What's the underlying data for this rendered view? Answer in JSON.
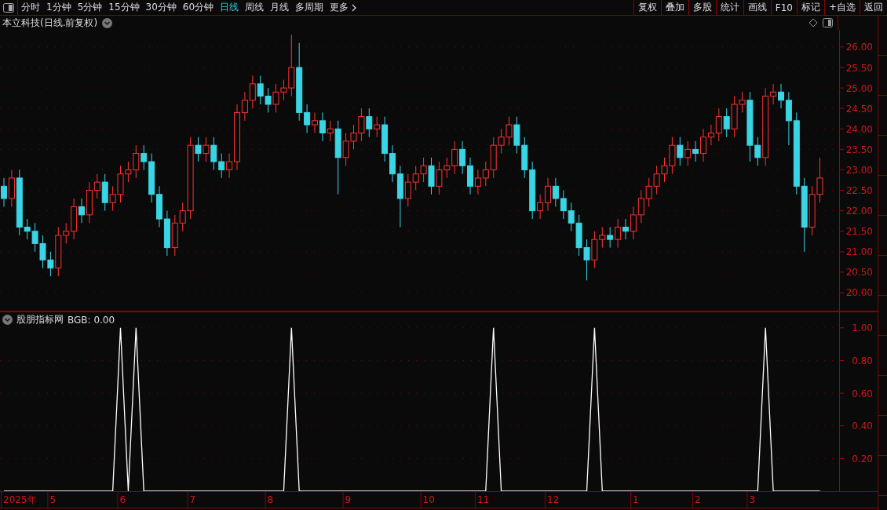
{
  "toolbar": {
    "periods": [
      {
        "label": "分时",
        "selected": false
      },
      {
        "label": "1分钟",
        "selected": false
      },
      {
        "label": "5分钟",
        "selected": false
      },
      {
        "label": "15分钟",
        "selected": false
      },
      {
        "label": "30分钟",
        "selected": false
      },
      {
        "label": "60分钟",
        "selected": false
      },
      {
        "label": "日线",
        "selected": true
      },
      {
        "label": "周线",
        "selected": false
      },
      {
        "label": "月线",
        "selected": false
      },
      {
        "label": "多周期",
        "selected": false
      }
    ],
    "more": "更多",
    "buttons": [
      "复权",
      "叠加",
      "多股",
      "统计",
      "画线",
      "F10",
      "标记",
      "+自选",
      "返回"
    ]
  },
  "price_panel": {
    "title": "本立科技(日线.前复权)",
    "chart_data": {
      "type": "candlestick",
      "grid": true,
      "ylim": [
        19.54,
        26.42
      ],
      "yticks": [
        {
          "value": 20,
          "label": "20.00"
        },
        {
          "value": 20.5,
          "label": "20.50"
        },
        {
          "value": 21,
          "label": "21.00"
        },
        {
          "value": 21.5,
          "label": "21.50"
        },
        {
          "value": 22,
          "label": "22.00"
        },
        {
          "value": 22.5,
          "label": "22.50"
        },
        {
          "value": 23,
          "label": "23.00"
        },
        {
          "value": 23.5,
          "label": "23.50"
        },
        {
          "value": 24,
          "label": "24.00"
        },
        {
          "value": 24.5,
          "label": "24.50"
        },
        {
          "value": 25,
          "label": "25.00"
        },
        {
          "value": 25.5,
          "label": "25.50"
        },
        {
          "value": 26,
          "label": "26.00"
        }
      ],
      "ohlc": [
        [
          22.6,
          22.8,
          22.1,
          22.3
        ],
        [
          22.3,
          23.0,
          22.1,
          22.8
        ],
        [
          22.8,
          23.0,
          21.4,
          21.6
        ],
        [
          21.6,
          21.8,
          21.3,
          21.5
        ],
        [
          21.5,
          21.7,
          21.0,
          21.2
        ],
        [
          21.2,
          21.4,
          20.6,
          20.8
        ],
        [
          20.8,
          21.0,
          20.4,
          20.6
        ],
        [
          20.6,
          21.6,
          20.4,
          21.4
        ],
        [
          21.4,
          21.7,
          21.2,
          21.5
        ],
        [
          21.5,
          22.3,
          21.3,
          22.1
        ],
        [
          22.1,
          22.3,
          21.7,
          21.9
        ],
        [
          21.9,
          22.7,
          21.7,
          22.5
        ],
        [
          22.5,
          22.9,
          22.3,
          22.7
        ],
        [
          22.7,
          22.9,
          22.0,
          22.2
        ],
        [
          22.2,
          22.6,
          22.0,
          22.4
        ],
        [
          22.4,
          23.1,
          22.2,
          22.9
        ],
        [
          22.9,
          23.2,
          22.7,
          23.0
        ],
        [
          23.0,
          23.6,
          22.8,
          23.4
        ],
        [
          23.4,
          23.6,
          23.0,
          23.2
        ],
        [
          23.2,
          23.4,
          22.2,
          22.4
        ],
        [
          22.4,
          22.6,
          21.6,
          21.8
        ],
        [
          21.8,
          22.0,
          20.9,
          21.1
        ],
        [
          21.1,
          21.9,
          20.9,
          21.7
        ],
        [
          21.7,
          22.2,
          21.5,
          22.0
        ],
        [
          22.0,
          23.8,
          21.8,
          23.6
        ],
        [
          23.6,
          23.8,
          23.2,
          23.4
        ],
        [
          23.4,
          23.8,
          23.2,
          23.6
        ],
        [
          23.6,
          23.8,
          23.0,
          23.2
        ],
        [
          23.2,
          23.4,
          22.8,
          23.0
        ],
        [
          23.0,
          23.4,
          22.8,
          23.2
        ],
        [
          23.2,
          24.6,
          23.0,
          24.4
        ],
        [
          24.4,
          24.9,
          24.2,
          24.7
        ],
        [
          24.7,
          25.3,
          24.5,
          25.1
        ],
        [
          25.1,
          25.3,
          24.6,
          24.8
        ],
        [
          24.8,
          25.0,
          24.4,
          24.6
        ],
        [
          24.6,
          25.1,
          24.4,
          24.9
        ],
        [
          24.9,
          25.2,
          24.7,
          25.0
        ],
        [
          25.0,
          26.3,
          24.8,
          25.5
        ],
        [
          25.5,
          26.1,
          24.2,
          24.4
        ],
        [
          24.4,
          24.6,
          23.9,
          24.1
        ],
        [
          24.1,
          24.4,
          23.9,
          24.2
        ],
        [
          24.2,
          24.4,
          23.7,
          23.9
        ],
        [
          23.9,
          24.2,
          23.7,
          24.0
        ],
        [
          24.0,
          24.2,
          22.4,
          23.3
        ],
        [
          23.3,
          23.9,
          23.1,
          23.7
        ],
        [
          23.7,
          24.1,
          23.5,
          23.9
        ],
        [
          23.9,
          24.5,
          23.7,
          24.3
        ],
        [
          24.3,
          24.5,
          23.8,
          24.0
        ],
        [
          24.0,
          24.3,
          23.8,
          24.1
        ],
        [
          24.1,
          24.3,
          23.2,
          23.4
        ],
        [
          23.4,
          23.6,
          22.7,
          22.9
        ],
        [
          22.9,
          23.1,
          21.6,
          22.3
        ],
        [
          22.3,
          22.9,
          22.1,
          22.7
        ],
        [
          22.7,
          23.1,
          22.5,
          22.9
        ],
        [
          22.9,
          23.3,
          22.7,
          23.1
        ],
        [
          23.1,
          23.3,
          22.4,
          22.6
        ],
        [
          22.6,
          23.2,
          22.4,
          23.0
        ],
        [
          23.0,
          23.3,
          22.8,
          23.1
        ],
        [
          23.1,
          23.7,
          22.9,
          23.5
        ],
        [
          23.5,
          23.7,
          22.9,
          23.1
        ],
        [
          23.1,
          23.3,
          22.4,
          22.6
        ],
        [
          22.6,
          23.0,
          22.4,
          22.8
        ],
        [
          22.8,
          23.2,
          22.6,
          23.0
        ],
        [
          23.0,
          23.8,
          22.8,
          23.6
        ],
        [
          23.6,
          24.0,
          23.4,
          23.8
        ],
        [
          23.8,
          24.3,
          23.6,
          24.1
        ],
        [
          24.1,
          24.3,
          23.4,
          23.6
        ],
        [
          23.6,
          23.8,
          22.8,
          23.0
        ],
        [
          23.0,
          23.2,
          21.8,
          22.0
        ],
        [
          22.0,
          22.4,
          21.8,
          22.2
        ],
        [
          22.2,
          22.8,
          22.0,
          22.6
        ],
        [
          22.6,
          22.8,
          22.1,
          22.3
        ],
        [
          22.3,
          22.5,
          21.8,
          22.0
        ],
        [
          22.0,
          22.2,
          21.5,
          21.7
        ],
        [
          21.7,
          21.9,
          20.9,
          21.1
        ],
        [
          21.1,
          21.3,
          20.3,
          20.8
        ],
        [
          20.8,
          21.5,
          20.6,
          21.3
        ],
        [
          21.3,
          21.6,
          21.1,
          21.4
        ],
        [
          21.4,
          21.6,
          21.1,
          21.3
        ],
        [
          21.3,
          21.8,
          21.1,
          21.6
        ],
        [
          21.6,
          21.8,
          21.3,
          21.5
        ],
        [
          21.5,
          22.1,
          21.3,
          21.9
        ],
        [
          21.9,
          22.5,
          21.7,
          22.3
        ],
        [
          22.3,
          22.8,
          22.1,
          22.6
        ],
        [
          22.6,
          23.1,
          22.4,
          22.9
        ],
        [
          22.9,
          23.3,
          22.7,
          23.1
        ],
        [
          23.1,
          23.8,
          22.9,
          23.6
        ],
        [
          23.6,
          23.8,
          23.1,
          23.3
        ],
        [
          23.3,
          23.7,
          23.1,
          23.5
        ],
        [
          23.5,
          23.7,
          23.2,
          23.4
        ],
        [
          23.4,
          24.0,
          23.2,
          23.8
        ],
        [
          23.8,
          24.1,
          23.6,
          23.9
        ],
        [
          23.9,
          24.5,
          23.7,
          24.3
        ],
        [
          24.3,
          24.5,
          23.8,
          24.0
        ],
        [
          24.0,
          24.8,
          23.8,
          24.6
        ],
        [
          24.6,
          24.9,
          24.4,
          24.7
        ],
        [
          24.7,
          24.9,
          23.2,
          23.6
        ],
        [
          23.6,
          23.8,
          23.1,
          23.3
        ],
        [
          23.3,
          25.0,
          23.1,
          24.8
        ],
        [
          24.8,
          25.1,
          24.6,
          24.9
        ],
        [
          24.9,
          25.1,
          24.5,
          24.7
        ],
        [
          24.7,
          24.9,
          23.6,
          24.2
        ],
        [
          24.2,
          24.4,
          22.4,
          22.6
        ],
        [
          22.6,
          22.8,
          21.0,
          21.6
        ],
        [
          21.6,
          22.6,
          21.4,
          22.4
        ],
        [
          22.4,
          23.3,
          22.2,
          22.8
        ]
      ]
    }
  },
  "indicator_panel": {
    "name": "股朋指标网",
    "reading": "BGB: 0.00",
    "chart_data": {
      "type": "line",
      "grid": true,
      "ylim": [
        0,
        1.1
      ],
      "yticks": [
        {
          "value": 0.2,
          "label": "0.20"
        },
        {
          "value": 0.4,
          "label": "0.40"
        },
        {
          "value": 0.6,
          "label": "0.60"
        },
        {
          "value": 0.8,
          "label": "0.80"
        },
        {
          "value": 1,
          "label": "1.00"
        }
      ],
      "series": [
        {
          "color": "#ffffff",
          "values": [
            0,
            0,
            0,
            0,
            0,
            0,
            0,
            0,
            0,
            0,
            0,
            0,
            0,
            0,
            0,
            1,
            0,
            1,
            0,
            0,
            0,
            0,
            0,
            0,
            0,
            0,
            0,
            0,
            0,
            0,
            0,
            0,
            0,
            0,
            0,
            0,
            0,
            1,
            0,
            0,
            0,
            0,
            0,
            0,
            0,
            0,
            0,
            0,
            0,
            0,
            0,
            0,
            0,
            0,
            0,
            0,
            0,
            0,
            0,
            0,
            0,
            0,
            0,
            1,
            0,
            0,
            0,
            0,
            0,
            0,
            0,
            0,
            0,
            0,
            0,
            0,
            1,
            0,
            0,
            0,
            0,
            0,
            0,
            0,
            0,
            0,
            0,
            0,
            0,
            0,
            0,
            0,
            0,
            0,
            0,
            0,
            0,
            0,
            1,
            0,
            0,
            0,
            0,
            0,
            0,
            0
          ]
        }
      ]
    }
  },
  "time_axis": {
    "labels": [
      "2025年",
      "5",
      "6",
      "7",
      "8",
      "9",
      "10",
      "11",
      "12",
      "1",
      "2",
      "3"
    ]
  }
}
